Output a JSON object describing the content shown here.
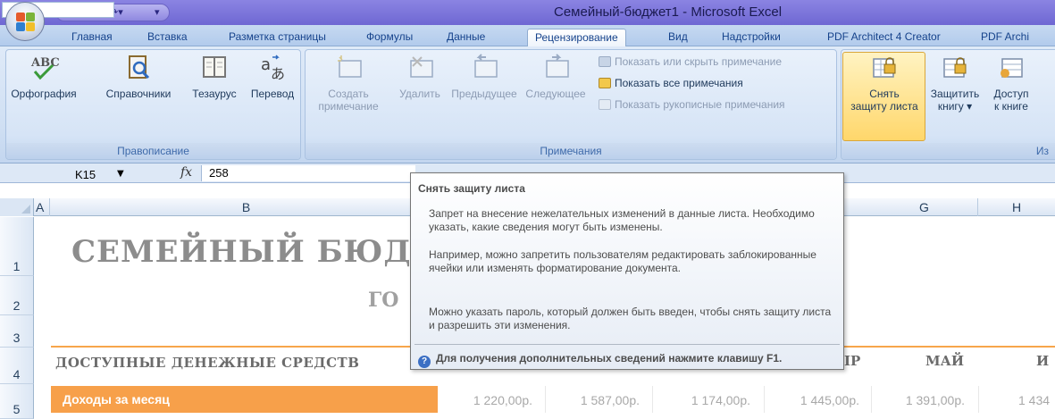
{
  "window": {
    "title": "Семейный-бюджет1 - Microsoft Excel"
  },
  "tabs": [
    {
      "label": "Главная"
    },
    {
      "label": "Вставка"
    },
    {
      "label": "Разметка страницы"
    },
    {
      "label": "Формулы"
    },
    {
      "label": "Данные"
    },
    {
      "label": "Рецензирование",
      "active": true
    },
    {
      "label": "Вид"
    },
    {
      "label": "Надстройки"
    },
    {
      "label": "PDF Architect 4 Creator"
    },
    {
      "label": "PDF Archi"
    }
  ],
  "ribbon": {
    "proofing": {
      "label": "Правописание",
      "spelling": "Орфография",
      "research": "Справочники",
      "thesaurus": "Тезаурус",
      "translate": "Перевод"
    },
    "comments": {
      "label": "Примечания",
      "new_line1": "Создать",
      "new_line2": "примечание",
      "delete": "Удалить",
      "previous": "Предыдущее",
      "next": "Следующее",
      "show_hide": "Показать или скрыть примечание",
      "show_all": "Показать все примечания",
      "show_ink": "Показать рукописные примечания"
    },
    "changes": {
      "label_partial": "Из",
      "unprotect_line1": "Снять",
      "unprotect_line2": "защиту листа",
      "protect_wb_line1": "Защитить",
      "protect_wb_line2": "книгу ▾",
      "share_line1": "Доступ",
      "share_line2": "к книге"
    }
  },
  "formula_bar": {
    "name_box": "K15",
    "fx": "fx",
    "value": "258"
  },
  "columns": [
    "A",
    "B",
    "G",
    "H"
  ],
  "rows": [
    "1",
    "2",
    "3",
    "4",
    "5"
  ],
  "sheet": {
    "title": "СЕМЕЙНЫЙ БЮД",
    "subtitle": "ГО",
    "section": "ДОСТУПНЫЕ ДЕНЕЖНЫЕ СРЕДСТВ",
    "months": [
      "ІР",
      "МАЙ",
      "И"
    ],
    "income_label": "Доходы за месяц",
    "income_values": [
      "1 220,00р.",
      "1 587,00р.",
      "1 174,00р.",
      "1 445,00р.",
      "1 391,00р.",
      "1 434"
    ]
  },
  "tooltip": {
    "title": "Снять защиту листа",
    "p1": "Запрет на внесение нежелательных изменений в данные листа. Необходимо указать, какие сведения могут быть изменены.",
    "p2": "Например, можно запретить пользователям редактировать заблокированные ячейки или изменять форматирование документа.",
    "p3": "Можно указать пароль, который должен быть введен, чтобы снять защиту листа и разрешить эти изменения.",
    "help": "Для получения дополнительных сведений нажмите клавишу F1."
  },
  "colors": {
    "accent_orange": "#f7a04a",
    "ribbon_blue": "#cfdff3",
    "title_bar": "#7a73da"
  }
}
